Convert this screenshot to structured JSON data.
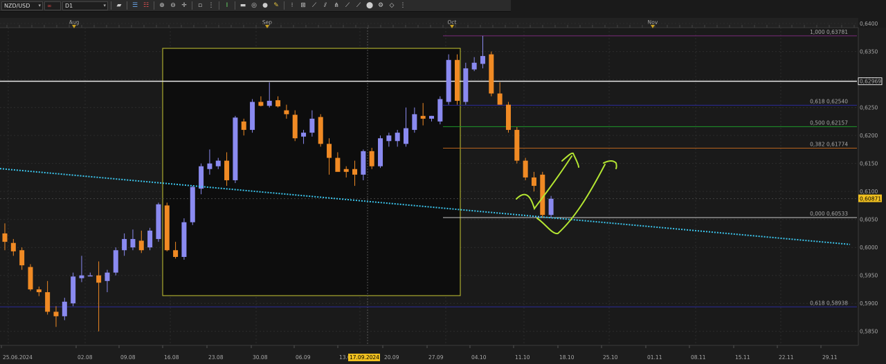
{
  "toolbar": {
    "symbol": "NZD/USD",
    "timeframe": "D1",
    "icons": [
      "chart-type-icon",
      "link-icon",
      "bar-icon",
      "candle-icon",
      "zoom-in-icon",
      "zoom-out-icon",
      "crosshair-icon",
      "cursor-icon",
      "text-icon",
      "label-icon",
      "shapes-icon",
      "pencil-icon",
      "fibonacci-icon",
      "grid-icon",
      "trendline-icon",
      "channel-icon",
      "pitchfork-icon",
      "circle-icon",
      "settings-icon",
      "eraser-icon"
    ]
  },
  "months": [
    {
      "label": "Aug"
    },
    {
      "label": "Sep"
    },
    {
      "label": "Oct"
    },
    {
      "label": "Nov"
    }
  ],
  "price_axis": [
    "0,6400",
    "0,6350",
    "0,6300",
    "0,6250",
    "0,6200",
    "0,6150",
    "0,6100",
    "0,6050",
    "0,6000",
    "0,5950",
    "0,5900",
    "0,5850"
  ],
  "date_axis": [
    "25.06.2024",
    "02.08",
    "09.08",
    "16.08",
    "23.08",
    "30.08",
    "06.09",
    "13.09",
    "20.09",
    "27.09",
    "04.10",
    "11.10",
    "18.10",
    "25.10",
    "01.11",
    "08.11",
    "15.11",
    "22.11",
    "29.11"
  ],
  "crosshair_date": "17.09.2024",
  "horizontal_line_price": "0,62969",
  "current_price": "0,60871",
  "fib_levels": [
    {
      "label": "1,000 0,63781",
      "color": "#7a2a7a"
    },
    {
      "label": "0,618 0,62540",
      "color": "#2a2a9a"
    },
    {
      "label": "0,500 0,62157",
      "color": "#1e9a2a"
    },
    {
      "label": "0,382 0,61774",
      "color": "#b8641e"
    },
    {
      "label": "0,000 0,60533",
      "color": "#c8c8c8"
    },
    {
      "label": "0,618 0,58938",
      "color": "#2a2a9a"
    }
  ],
  "chart_data": {
    "type": "candlestick",
    "symbol": "NZD/USD",
    "timeframe": "D1",
    "ylim": [
      0.5825,
      0.641
    ],
    "colors": {
      "bull": "#8a8af0",
      "bear": "#f08a24",
      "trend": "#3cc8f0",
      "box": "#c8c832",
      "annotation": "#b4e632"
    },
    "candles": [
      {
        "o": 0.6025,
        "h": 0.6043,
        "l": 0.5995,
        "c": 0.601
      },
      {
        "o": 0.6008,
        "h": 0.6015,
        "l": 0.5985,
        "c": 0.5993
      },
      {
        "o": 0.5995,
        "h": 0.6,
        "l": 0.596,
        "c": 0.5968
      },
      {
        "o": 0.5965,
        "h": 0.597,
        "l": 0.5922,
        "c": 0.5925
      },
      {
        "o": 0.5925,
        "h": 0.593,
        "l": 0.5913,
        "c": 0.592
      },
      {
        "o": 0.592,
        "h": 0.594,
        "l": 0.588,
        "c": 0.5885
      },
      {
        "o": 0.5885,
        "h": 0.5895,
        "l": 0.5858,
        "c": 0.5877
      },
      {
        "o": 0.5877,
        "h": 0.591,
        "l": 0.587,
        "c": 0.5903
      },
      {
        "o": 0.59,
        "h": 0.5955,
        "l": 0.5895,
        "c": 0.5948
      },
      {
        "o": 0.5945,
        "h": 0.5985,
        "l": 0.5938,
        "c": 0.595
      },
      {
        "o": 0.595,
        "h": 0.5955,
        "l": 0.595,
        "c": 0.595
      },
      {
        "o": 0.595,
        "h": 0.5975,
        "l": 0.585,
        "c": 0.5937
      },
      {
        "o": 0.594,
        "h": 0.596,
        "l": 0.592,
        "c": 0.5955
      },
      {
        "o": 0.5955,
        "h": 0.6,
        "l": 0.595,
        "c": 0.5995
      },
      {
        "o": 0.5995,
        "h": 0.6025,
        "l": 0.5985,
        "c": 0.6015
      },
      {
        "o": 0.6,
        "h": 0.6032,
        "l": 0.5995,
        "c": 0.6015
      },
      {
        "o": 0.6012,
        "h": 0.603,
        "l": 0.599,
        "c": 0.5995
      },
      {
        "o": 0.6,
        "h": 0.6035,
        "l": 0.5995,
        "c": 0.603
      },
      {
        "o": 0.6015,
        "h": 0.608,
        "l": 0.601,
        "c": 0.6077
      },
      {
        "o": 0.6075,
        "h": 0.608,
        "l": 0.5993,
        "c": 0.5995
      },
      {
        "o": 0.5995,
        "h": 0.601,
        "l": 0.598,
        "c": 0.5983
      },
      {
        "o": 0.5983,
        "h": 0.6052,
        "l": 0.5978,
        "c": 0.6045
      },
      {
        "o": 0.6045,
        "h": 0.611,
        "l": 0.604,
        "c": 0.6108
      },
      {
        "o": 0.6105,
        "h": 0.615,
        "l": 0.6095,
        "c": 0.6145
      },
      {
        "o": 0.614,
        "h": 0.6175,
        "l": 0.613,
        "c": 0.615
      },
      {
        "o": 0.6145,
        "h": 0.616,
        "l": 0.614,
        "c": 0.6155
      },
      {
        "o": 0.6155,
        "h": 0.617,
        "l": 0.611,
        "c": 0.612
      },
      {
        "o": 0.612,
        "h": 0.6235,
        "l": 0.6115,
        "c": 0.6232
      },
      {
        "o": 0.6225,
        "h": 0.623,
        "l": 0.62,
        "c": 0.621
      },
      {
        "o": 0.621,
        "h": 0.6265,
        "l": 0.6205,
        "c": 0.626
      },
      {
        "o": 0.626,
        "h": 0.627,
        "l": 0.6252,
        "c": 0.6253
      },
      {
        "o": 0.6253,
        "h": 0.6295,
        "l": 0.625,
        "c": 0.6262
      },
      {
        "o": 0.6263,
        "h": 0.627,
        "l": 0.625,
        "c": 0.6252
      },
      {
        "o": 0.6245,
        "h": 0.6255,
        "l": 0.623,
        "c": 0.6238
      },
      {
        "o": 0.6237,
        "h": 0.6245,
        "l": 0.619,
        "c": 0.6195
      },
      {
        "o": 0.6198,
        "h": 0.621,
        "l": 0.6185,
        "c": 0.6205
      },
      {
        "o": 0.6205,
        "h": 0.6245,
        "l": 0.6198,
        "c": 0.623
      },
      {
        "o": 0.6233,
        "h": 0.6238,
        "l": 0.618,
        "c": 0.6185
      },
      {
        "o": 0.6185,
        "h": 0.6195,
        "l": 0.613,
        "c": 0.616
      },
      {
        "o": 0.616,
        "h": 0.617,
        "l": 0.6145,
        "c": 0.6135
      },
      {
        "o": 0.614,
        "h": 0.6145,
        "l": 0.6125,
        "c": 0.6135
      },
      {
        "o": 0.614,
        "h": 0.6155,
        "l": 0.611,
        "c": 0.613
      },
      {
        "o": 0.613,
        "h": 0.6175,
        "l": 0.612,
        "c": 0.6172
      },
      {
        "o": 0.6172,
        "h": 0.6178,
        "l": 0.614,
        "c": 0.6145
      },
      {
        "o": 0.6145,
        "h": 0.62,
        "l": 0.6142,
        "c": 0.6195
      },
      {
        "o": 0.619,
        "h": 0.6205,
        "l": 0.618,
        "c": 0.62
      },
      {
        "o": 0.619,
        "h": 0.621,
        "l": 0.618,
        "c": 0.6205
      },
      {
        "o": 0.6185,
        "h": 0.625,
        "l": 0.618,
        "c": 0.6213
      },
      {
        "o": 0.621,
        "h": 0.625,
        "l": 0.6205,
        "c": 0.6238
      },
      {
        "o": 0.6235,
        "h": 0.6258,
        "l": 0.6218,
        "c": 0.623
      },
      {
        "o": 0.623,
        "h": 0.6235,
        "l": 0.6225,
        "c": 0.6235
      },
      {
        "o": 0.6225,
        "h": 0.627,
        "l": 0.622,
        "c": 0.6265
      },
      {
        "o": 0.626,
        "h": 0.6345,
        "l": 0.6255,
        "c": 0.6335
      },
      {
        "o": 0.6335,
        "h": 0.6345,
        "l": 0.6255,
        "c": 0.6262
      },
      {
        "o": 0.626,
        "h": 0.633,
        "l": 0.6255,
        "c": 0.632
      },
      {
        "o": 0.6318,
        "h": 0.634,
        "l": 0.6315,
        "c": 0.633
      },
      {
        "o": 0.6328,
        "h": 0.6378,
        "l": 0.632,
        "c": 0.6342
      },
      {
        "o": 0.6345,
        "h": 0.635,
        "l": 0.627,
        "c": 0.6275
      },
      {
        "o": 0.6275,
        "h": 0.6295,
        "l": 0.6255,
        "c": 0.6255
      },
      {
        "o": 0.6255,
        "h": 0.626,
        "l": 0.6205,
        "c": 0.621
      },
      {
        "o": 0.621,
        "h": 0.6215,
        "l": 0.615,
        "c": 0.6155
      },
      {
        "o": 0.6155,
        "h": 0.616,
        "l": 0.612,
        "c": 0.6125
      },
      {
        "o": 0.6125,
        "h": 0.6135,
        "l": 0.61,
        "c": 0.611
      },
      {
        "o": 0.613,
        "h": 0.6135,
        "l": 0.6053,
        "c": 0.6058
      },
      {
        "o": 0.6058,
        "h": 0.6092,
        "l": 0.6053,
        "c": 0.6087
      }
    ],
    "horizontal_line": 0.62969,
    "current_price": 0.60871,
    "fib_a": [
      0.63781,
      0.6254,
      0.62157,
      0.61774,
      0.60533
    ],
    "fib_b": [
      0.58938
    ],
    "trendline": [
      {
        "t": 0,
        "p": 0.614
      },
      {
        "t": 64,
        "p": 0.6053
      }
    ]
  }
}
